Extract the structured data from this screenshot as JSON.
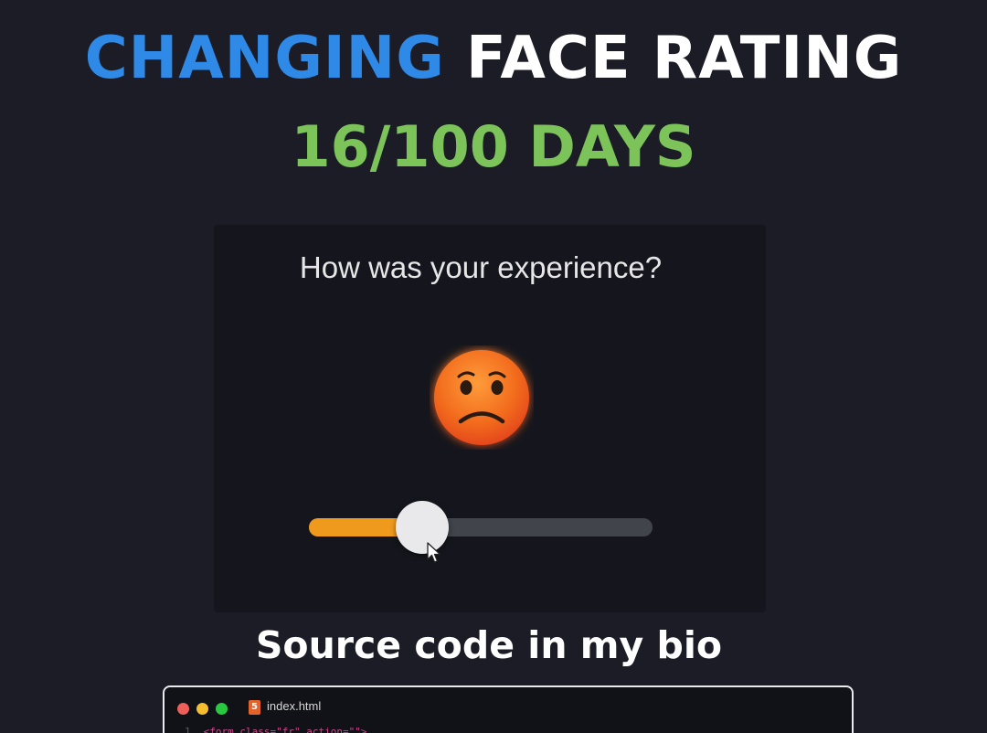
{
  "header": {
    "title_accent": "CHANGING",
    "title_rest": "FACE RATING",
    "progress_text": "16/100 DAYS"
  },
  "card": {
    "question": "How was your experience?",
    "face_icon": "sad-face-icon",
    "rating": {
      "value": 0.33
    }
  },
  "cta": "Source code in my bio",
  "editor": {
    "file_name": "index.html",
    "file_icon": "html5-icon",
    "code_line_number": "1",
    "code_line": "<form class=\"fr\" action=\"\">"
  },
  "colors": {
    "accent_blue": "#2e8ae6",
    "progress_green": "#7cc45a",
    "slider_fill": "#ef9a1c",
    "face_orange": "#f26b1d"
  }
}
